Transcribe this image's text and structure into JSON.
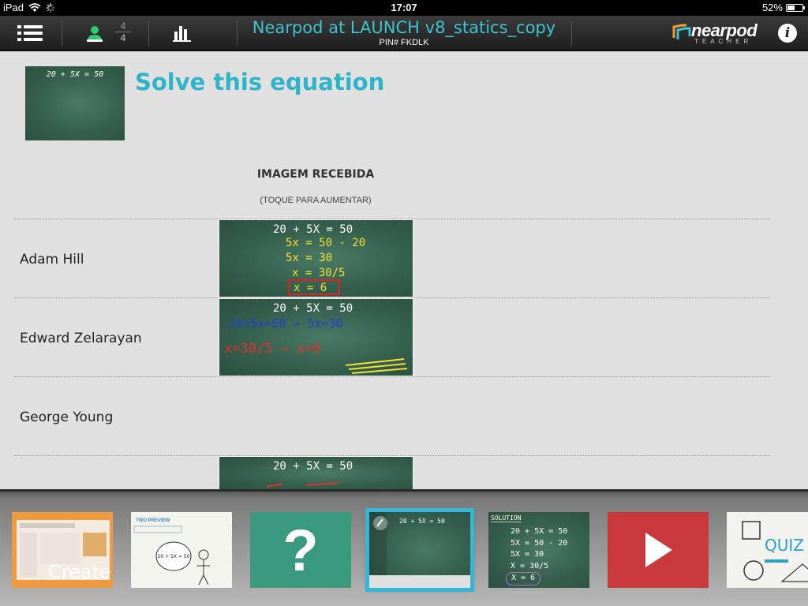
{
  "status_bar": {
    "device": "iPad",
    "time": "17:07",
    "battery": "52%",
    "battery_level": 0.52
  },
  "header": {
    "title": "Nearpod at LAUNCH v8_statics_copy",
    "pin": "PIN# FKDLK",
    "students_connected": "4",
    "students_total": "4",
    "logo_word": "nearpod",
    "logo_sub": "TEACHER",
    "info_glyph": "i"
  },
  "question": {
    "thumb_equation": "20 + 5X = 50",
    "title": "Solve this equation",
    "column_title": "IMAGEM RECEBIDA",
    "column_hint": "(TOQUE PARA AUMENTAR)"
  },
  "responses": [
    {
      "name": "Adam Hill",
      "lines": [
        "20 + 5X = 50",
        "5x = 50 - 20",
        "5x = 30",
        "x = 30/5",
        "x = 6"
      ]
    },
    {
      "name": "Edward Zelarayan",
      "lines": [
        "20 + 5X = 50",
        "20+5x=50 ⇒ 5x=30",
        "x=30/5 ⇒ x=6"
      ]
    },
    {
      "name": "George Young",
      "lines": []
    },
    {
      "name": "",
      "lines": [
        "20 + 5X = 50"
      ]
    }
  ],
  "slides": [
    {
      "kind": "create",
      "label": "Create"
    },
    {
      "kind": "preview",
      "heading": "TWO PREVIEW",
      "equation": "20 + 5X = 50"
    },
    {
      "kind": "question",
      "glyph": "?"
    },
    {
      "kind": "draw",
      "equation": "20 + 5X = 50"
    },
    {
      "kind": "solution",
      "heading": "SOLUTION",
      "lines": [
        "20 + 5X = 50",
        "5X = 50 - 20",
        "5X = 30",
        "X = 30/5",
        "X = 6"
      ]
    },
    {
      "kind": "video"
    },
    {
      "kind": "quiz",
      "label": "QUIZ"
    }
  ],
  "colors": {
    "accent": "#3ec4d0",
    "chalkboard": "#3b6654",
    "active_slide": "#35b6d6"
  }
}
